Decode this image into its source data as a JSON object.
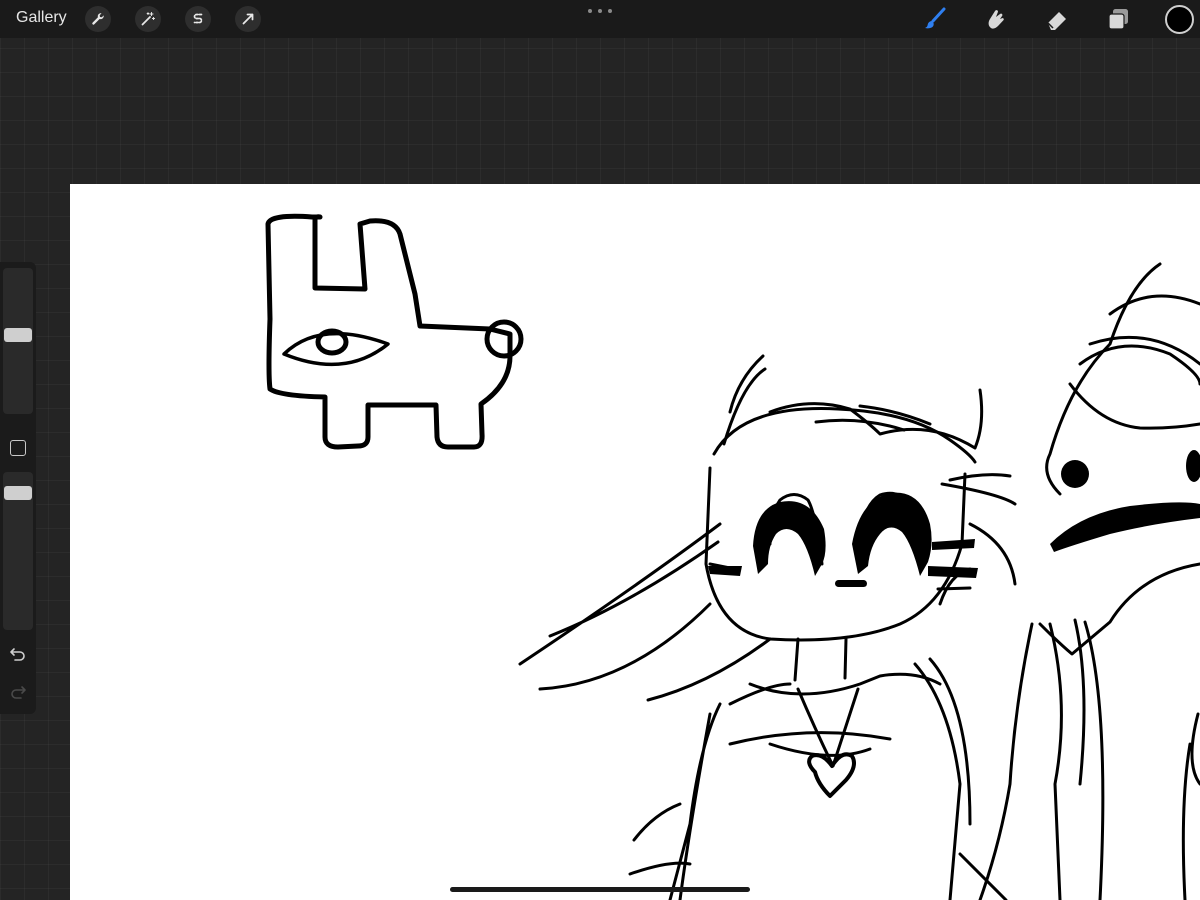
{
  "topbar": {
    "gallery_label": "Gallery",
    "left_tools": [
      {
        "name": "actions",
        "icon": "wrench-icon"
      },
      {
        "name": "adjustments",
        "icon": "magic-wand-icon"
      },
      {
        "name": "selection",
        "icon": "selection-s-icon"
      },
      {
        "name": "transform",
        "icon": "arrow-cursor-icon"
      }
    ],
    "right_tools": [
      {
        "name": "brush",
        "icon": "brush-icon",
        "active": true
      },
      {
        "name": "smudge",
        "icon": "smudge-finger-icon",
        "active": false
      },
      {
        "name": "eraser",
        "icon": "eraser-icon",
        "active": false
      },
      {
        "name": "layers",
        "icon": "layers-icon",
        "active": false
      }
    ],
    "active_color": "#000000",
    "accent_color": "#2f7ff0"
  },
  "sidebar": {
    "brush_size_level": 0.5,
    "opacity_level": 0.1,
    "icons": [
      "square-modify-icon",
      "undo-icon",
      "redo-icon"
    ]
  }
}
